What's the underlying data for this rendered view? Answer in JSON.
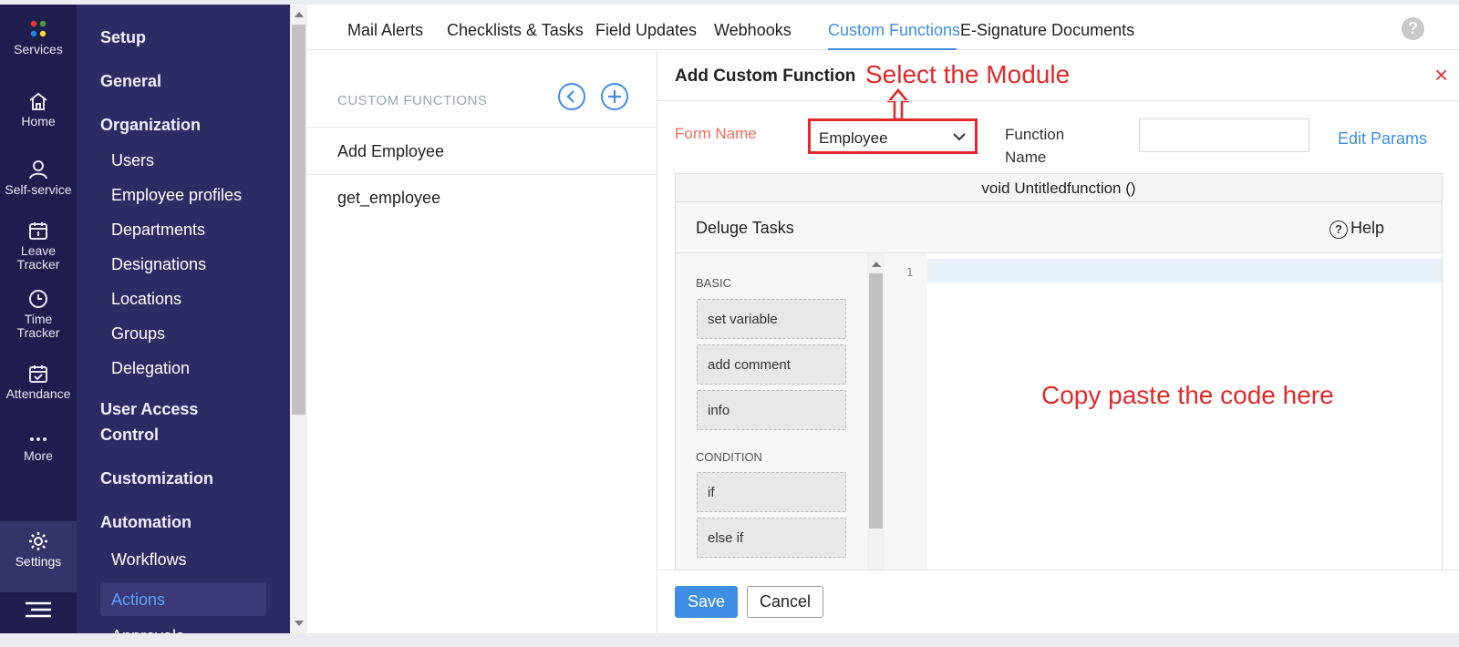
{
  "rail": {
    "services": "Services",
    "home": "Home",
    "self_service": "Self-service",
    "leave_tracker": [
      "Leave",
      "Tracker"
    ],
    "time_tracker": [
      "Time",
      "Tracker"
    ],
    "attendance": "Attendance",
    "more": "More",
    "settings": "Settings"
  },
  "setup": {
    "title": "Setup",
    "general": "General",
    "organization": "Organization",
    "org_items": [
      "Users",
      "Employee profiles",
      "Departments",
      "Designations",
      "Locations",
      "Groups",
      "Delegation"
    ],
    "uac_line1": "User Access",
    "uac_line2": "Control",
    "customization": "Customization",
    "automation": "Automation",
    "auto_items": [
      "Workflows",
      "Actions",
      "Approvals"
    ]
  },
  "tabs": [
    "Mail Alerts",
    "Checklists & Tasks",
    "Field Updates",
    "Webhooks",
    "Custom Functions",
    "E-Signature Documents"
  ],
  "tabs_active": "Custom Functions",
  "help_glyph": "?",
  "cflist": {
    "header": "CUSTOM FUNCTIONS",
    "items": [
      "Add Employee",
      "get_employee"
    ]
  },
  "panel": {
    "title": "Add Custom Function",
    "annotation_module": "Select the Module",
    "close_glyph": "×",
    "form_name_label": "Form Name",
    "form_name_value": "Employee",
    "function_name_label": [
      "Function",
      "Name"
    ],
    "function_name_value": "",
    "edit_params": "Edit Params",
    "signature": "void Untitledfunction ()",
    "deluge_tasks": "Deluge Tasks",
    "help": "Help",
    "palette": {
      "basic_header": "BASIC",
      "basic": [
        "set variable",
        "add comment",
        "info"
      ],
      "condition_header": "CONDITION",
      "condition": [
        "if",
        "else if"
      ]
    },
    "line_number": "1",
    "annotation_code": "Copy paste the code here",
    "save": "Save",
    "cancel": "Cancel"
  },
  "colors": {
    "rail_bg": "#1f1d4d",
    "sidebar_bg": "#2d2b63",
    "accent": "#3f8ee6",
    "annotation": "#e22a2a",
    "form_label": "#f26b5b"
  }
}
